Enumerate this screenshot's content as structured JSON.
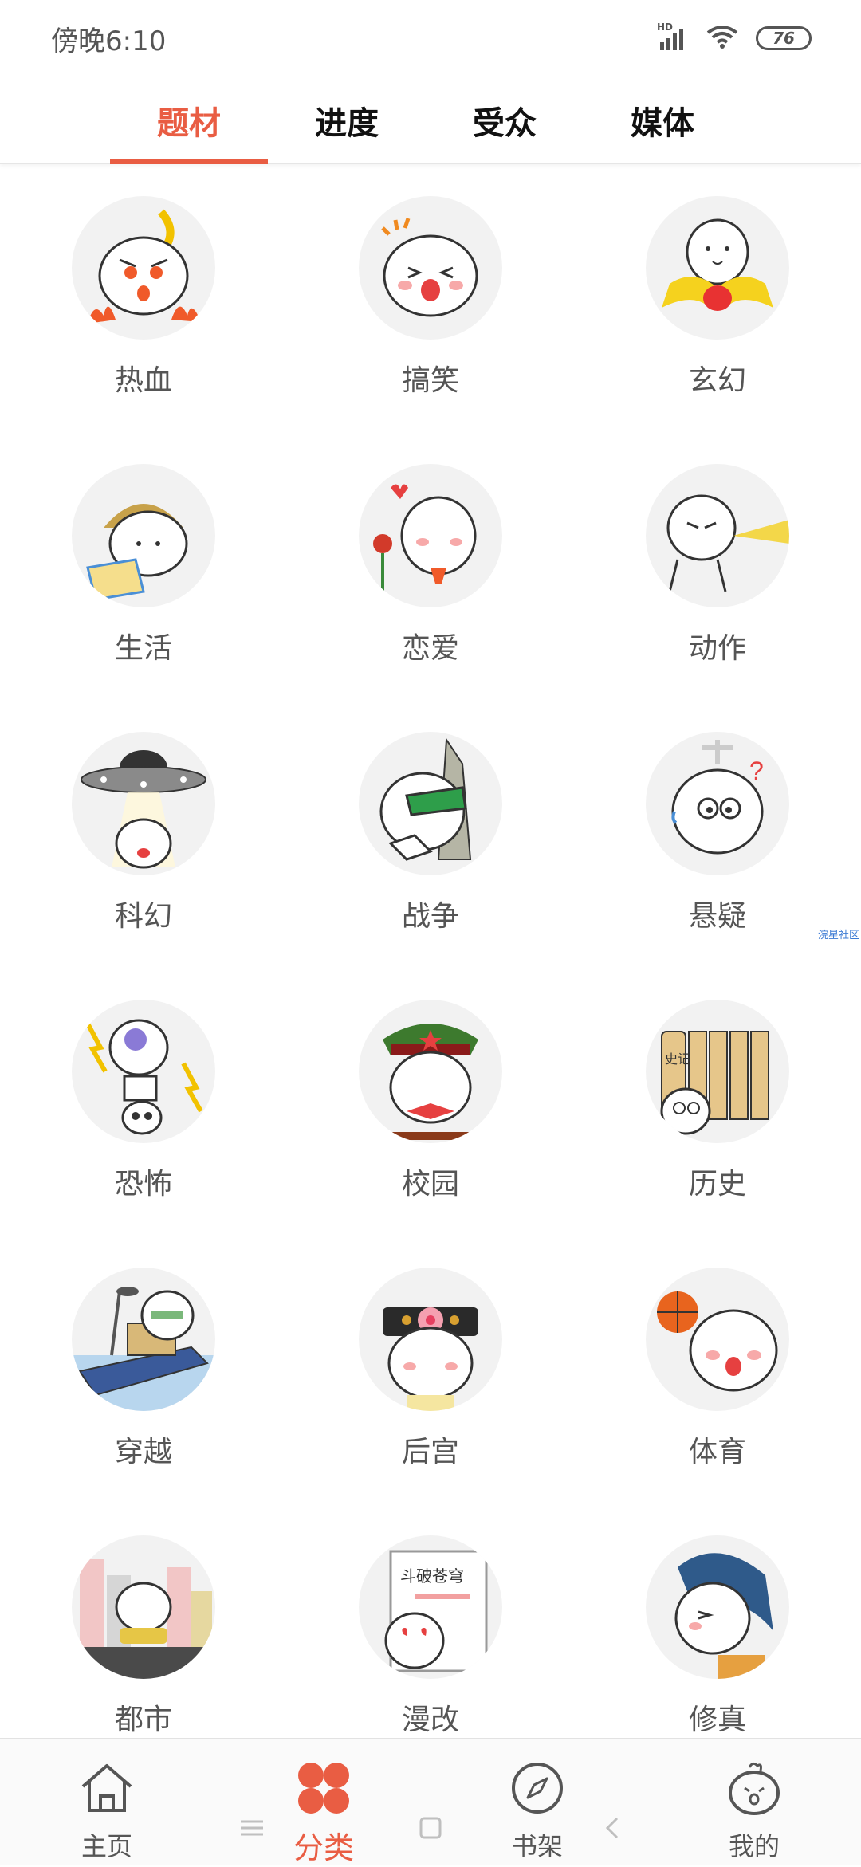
{
  "status_bar": {
    "time": "傍晚6:10",
    "network_badge": "HD",
    "battery": "76"
  },
  "tabs": [
    {
      "label": "题材",
      "active": true
    },
    {
      "label": "进度",
      "active": false
    },
    {
      "label": "受众",
      "active": false
    },
    {
      "label": "媒体",
      "active": false
    }
  ],
  "categories": [
    {
      "label": "热血",
      "icon": "hot-blood-mascot-icon"
    },
    {
      "label": "搞笑",
      "icon": "funny-mascot-icon"
    },
    {
      "label": "玄幻",
      "icon": "fantasy-mascot-icon"
    },
    {
      "label": "生活",
      "icon": "life-mascot-icon"
    },
    {
      "label": "恋爱",
      "icon": "romance-mascot-icon"
    },
    {
      "label": "动作",
      "icon": "action-mascot-icon"
    },
    {
      "label": "科幻",
      "icon": "scifi-ufo-mascot-icon"
    },
    {
      "label": "战争",
      "icon": "war-mascot-icon"
    },
    {
      "label": "悬疑",
      "icon": "mystery-mascot-icon"
    },
    {
      "label": "恐怖",
      "icon": "horror-skull-mascot-icon"
    },
    {
      "label": "校园",
      "icon": "campus-mascot-icon"
    },
    {
      "label": "历史",
      "icon": "history-bamboo-mascot-icon"
    },
    {
      "label": "穿越",
      "icon": "time-travel-boat-mascot-icon"
    },
    {
      "label": "后宫",
      "icon": "palace-mascot-icon"
    },
    {
      "label": "体育",
      "icon": "sports-basketball-mascot-icon"
    },
    {
      "label": "都市",
      "icon": "city-mascot-icon"
    },
    {
      "label": "漫改",
      "icon": "adaptation-book-mascot-icon"
    },
    {
      "label": "修真",
      "icon": "cultivation-mascot-icon"
    }
  ],
  "book_cover_text": "斗破苍穹",
  "bamboo_text": "史记",
  "watermark": "浣星社区",
  "bottom_nav": [
    {
      "label": "主页",
      "icon": "home-icon",
      "active": false
    },
    {
      "label": "分类",
      "icon": "category-icon",
      "active": true
    },
    {
      "label": "书架",
      "icon": "compass-icon",
      "active": false
    },
    {
      "label": "我的",
      "icon": "profile-mascot-icon",
      "active": false
    }
  ],
  "colors": {
    "accent": "#e95d43",
    "text": "#555555",
    "avatar_bg": "#f2f2f2"
  }
}
